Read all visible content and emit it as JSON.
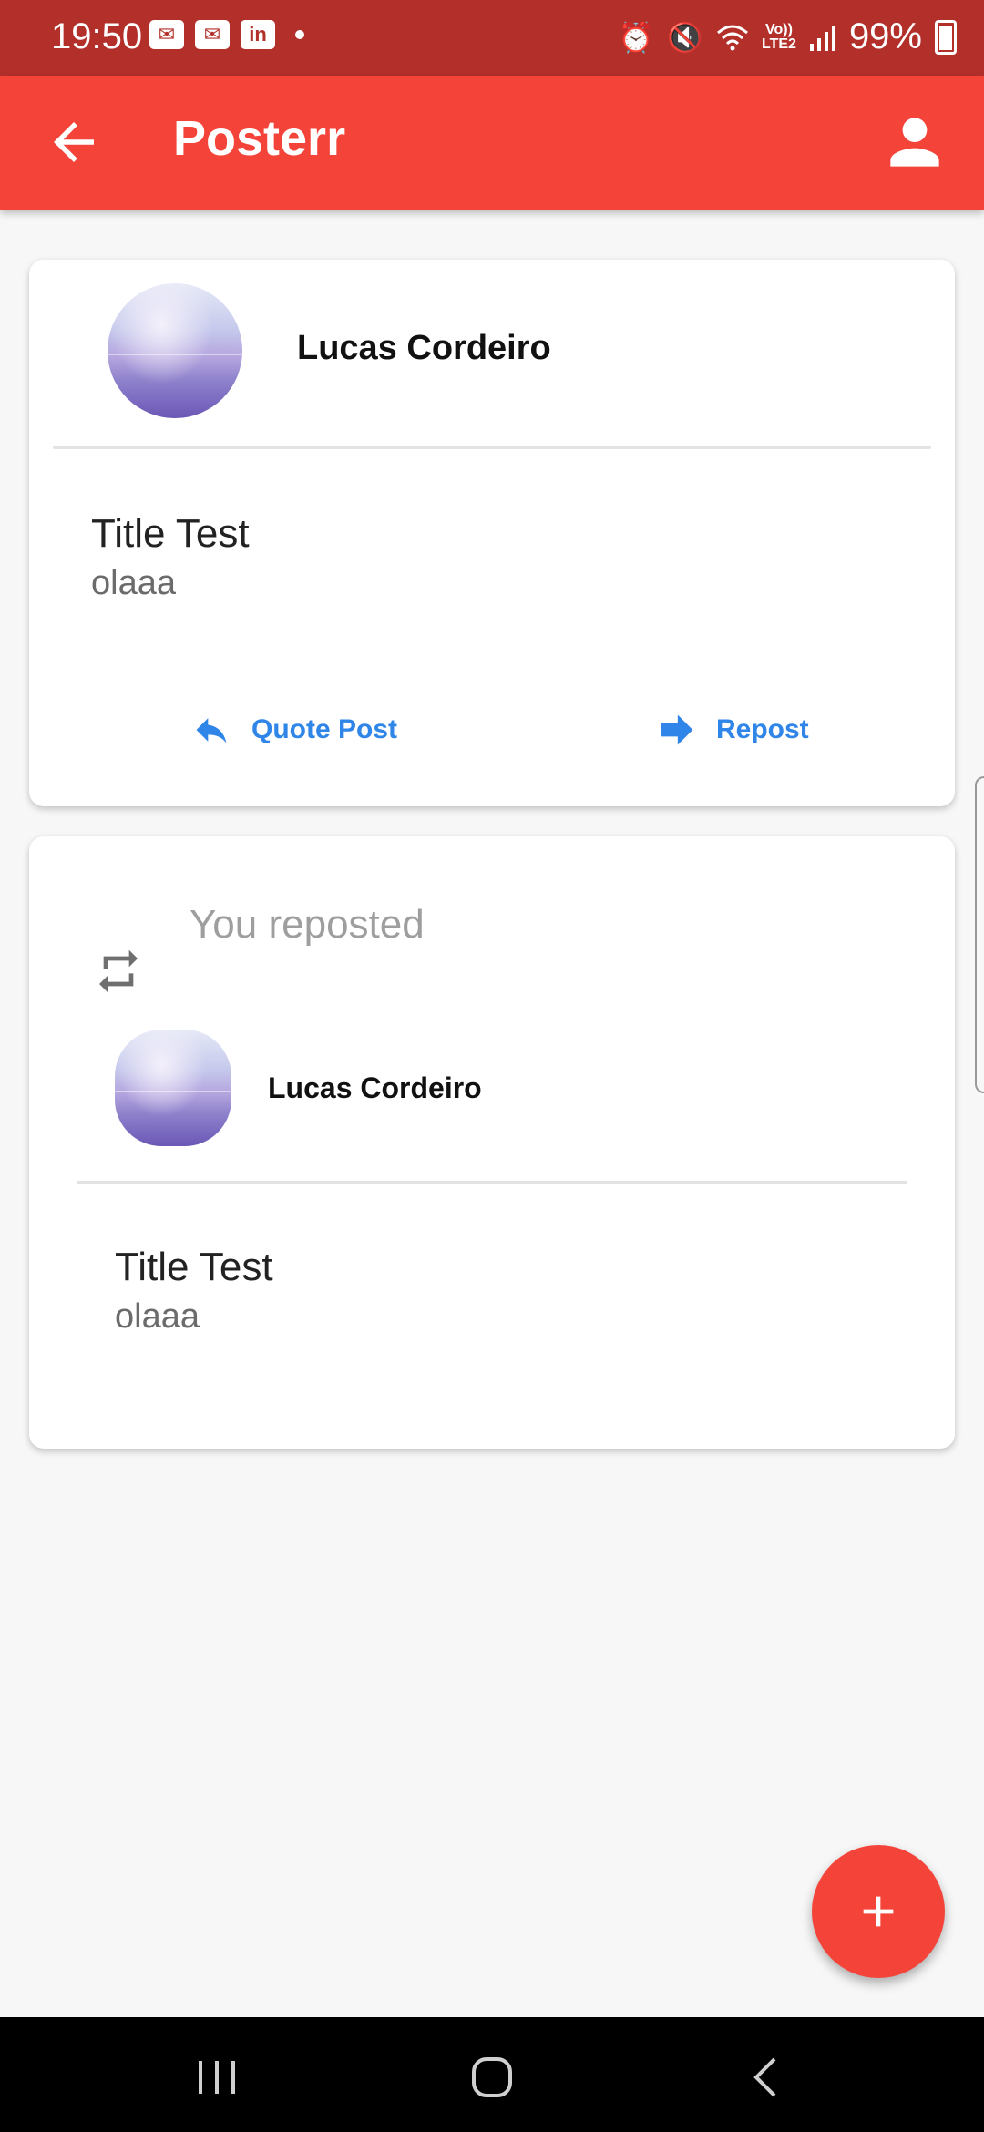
{
  "status_bar": {
    "time": "19:50",
    "notification_icons": [
      "outlook-icon",
      "outlook-icon",
      "linkedin-icon"
    ],
    "right_icons": [
      "alarm-icon",
      "mute-icon",
      "wifi-icon",
      "volte-icon",
      "signal-icon"
    ],
    "volte_top": "Vo))",
    "volte_bottom": "LTE2",
    "battery": "99%"
  },
  "app_bar": {
    "title": "Posterr",
    "back_icon": "arrow-back-icon",
    "profile_icon": "person-icon"
  },
  "posts": [
    {
      "author": "Lucas Cordeiro",
      "title": "Title Test",
      "body": "olaaa",
      "actions": {
        "quote_label": "Quote Post",
        "repost_label": "Repost"
      }
    }
  ],
  "reposts": [
    {
      "label": "You reposted",
      "author": "Lucas Cordeiro",
      "title": "Title Test",
      "body": "olaaa"
    }
  ],
  "fab": {
    "icon": "plus-icon"
  },
  "colors": {
    "primary": "#f4443a",
    "status_bar": "#b3302a",
    "action_blue": "#2f86e8",
    "background": "#f7f7f7"
  }
}
